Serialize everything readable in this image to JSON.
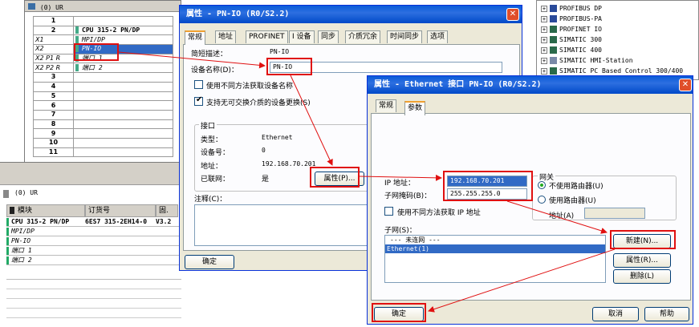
{
  "hw_config": {
    "header": "(0) UR",
    "rows": [
      {
        "slot": "1",
        "module": ""
      },
      {
        "slot": "2",
        "module": "CPU 315-2 PN/DP"
      },
      {
        "slot": "X1",
        "module": "MPI/DP"
      },
      {
        "slot": "X2",
        "module": "PN-IO"
      },
      {
        "slot": "X2 P1 R",
        "module": "端口 1"
      },
      {
        "slot": "X2 P2 R",
        "module": "端口 2"
      },
      {
        "slot": "3",
        "module": ""
      },
      {
        "slot": "4",
        "module": ""
      },
      {
        "slot": "5",
        "module": ""
      },
      {
        "slot": "6",
        "module": ""
      },
      {
        "slot": "7",
        "module": ""
      },
      {
        "slot": "8",
        "module": ""
      },
      {
        "slot": "9",
        "module": ""
      },
      {
        "slot": "10",
        "module": ""
      },
      {
        "slot": "11",
        "module": ""
      }
    ]
  },
  "config_table": {
    "title": "(0)    UR",
    "columns": [
      "模块",
      "订货号",
      "固."
    ],
    "rows": [
      {
        "module": "CPU 315-2 PN/DP",
        "order": "6ES7 315-2EH14-0",
        "fw": "V3.2"
      },
      {
        "module": "MPI/DP",
        "order": "",
        "fw": ""
      },
      {
        "module": "PN-IO",
        "order": "",
        "fw": ""
      },
      {
        "module": "端口 1",
        "order": "",
        "fw": ""
      },
      {
        "module": "端口 2",
        "order": "",
        "fw": ""
      }
    ]
  },
  "pnio_dialog": {
    "title": "属性 - PN-IO (R0/S2.2)",
    "tabs": [
      "常规",
      "地址",
      "PROFINET",
      "I 设备",
      "同步",
      "介质冗余",
      "时间同步",
      "选项"
    ],
    "short_desc_label": "简短描述：",
    "short_desc_value": "PN-IO",
    "device_name_label": "设备名称(D)：",
    "device_name_value": "PN-IO",
    "chk_other_method": "使用不同方法获取设备名称",
    "chk_support_replace": "支持无可交换介质的设备更换(S)",
    "interface_group": "接口",
    "type_label": "类型：",
    "type_value": "Ethernet",
    "device_no_label": "设备号：",
    "device_no_value": "0",
    "address_label": "地址：",
    "address_value": "192.168.70.201",
    "networked_label": "已联网：",
    "networked_value": "是",
    "properties_button": "属性(P)...",
    "comment_label": "注释(C)：",
    "ok_button": "确定"
  },
  "ethernet_dialog": {
    "title": "属性 - Ethernet 接口  PN-IO (R0/S2.2)",
    "tabs": [
      "常规",
      "参数"
    ],
    "ip_label": "IP 地址：",
    "ip_value": "192.168.70.201",
    "mask_label": "子网掩码(B)：",
    "mask_value": "255.255.255.0",
    "chk_other_ip": "使用不同方法获取 IP 地址",
    "gateway_group": "网关",
    "radio_no_router": "不使用路由器(U)",
    "radio_use_router": "使用路由器(U)",
    "gw_address_label": "地址(A)",
    "subnet_label": "子网(S)：",
    "subnets": [
      "--- 未连网 ---",
      "Ethernet(1)"
    ],
    "new_button": "新建(N)...",
    "properties_button": "属性(R)...",
    "delete_button": "删除(L)",
    "ok_button": "确定",
    "cancel_button": "取消",
    "help_button": "帮助"
  },
  "catalog_tree": {
    "items": [
      "PROFIBUS DP",
      "PROFIBUS-PA",
      "PROFINET IO",
      "SIMATIC 300",
      "SIMATIC 400",
      "SIMATIC HMI-Station",
      "SIMATIC PC Based Control 300/400"
    ]
  },
  "colors": {
    "highlight": "#e01010",
    "titlebar": "#0a5bd8",
    "dialog_bg": "#ece9d8"
  }
}
